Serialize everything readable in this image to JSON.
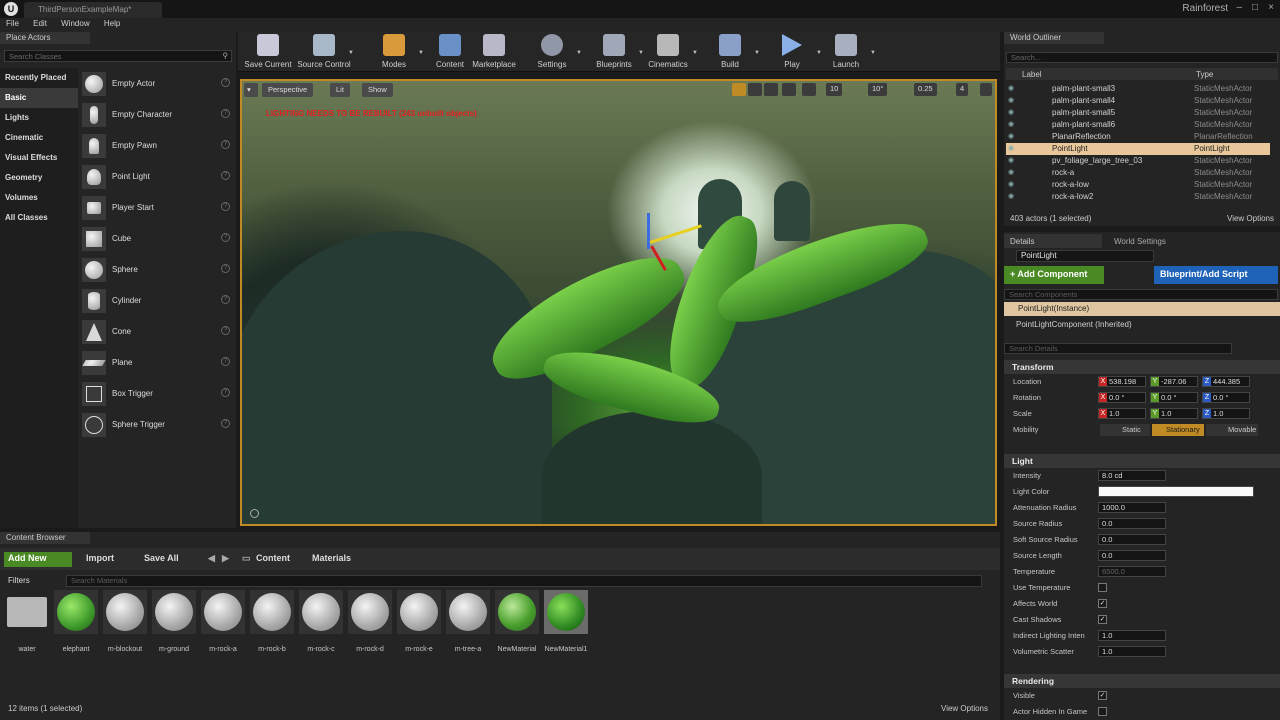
{
  "titlebar": {
    "tab": "ThirdPersonExampleMap*",
    "project": "Rainforest",
    "controls": [
      "–",
      "□",
      "×"
    ]
  },
  "menu": [
    "File",
    "Edit",
    "Window",
    "Help"
  ],
  "place_actors": {
    "tab": "Place Actors",
    "search_placeholder": "Search Classes",
    "categories": [
      "Recently Placed",
      "Basic",
      "Lights",
      "Cinematic",
      "Visual Effects",
      "Geometry",
      "Volumes",
      "All Classes"
    ],
    "active_category": "Basic",
    "items": [
      "Empty Actor",
      "Empty Character",
      "Empty Pawn",
      "Point Light",
      "Player Start",
      "Cube",
      "Sphere",
      "Cylinder",
      "Cone",
      "Plane",
      "Box Trigger",
      "Sphere Trigger"
    ]
  },
  "toolbar": [
    {
      "label": "Save Current",
      "color": "#d8d8e8"
    },
    {
      "label": "Source Control",
      "color": "#b8c8d8"
    },
    {
      "label": "Modes",
      "color": "#e0a040"
    },
    {
      "label": "Content",
      "color": "#7aa0d0"
    },
    {
      "label": "Marketplace",
      "color": "#c8c8d8"
    },
    {
      "label": "Settings",
      "color": "#a0a8b8"
    },
    {
      "label": "Blueprints",
      "color": "#b0b8c8"
    },
    {
      "label": "Cinematics",
      "color": "#c8c8c8"
    },
    {
      "label": "Build",
      "color": "#9ab0d8"
    },
    {
      "label": "Play",
      "color": "#8ab0e8"
    },
    {
      "label": "Launch",
      "color": "#b8c0d0"
    }
  ],
  "viewport": {
    "buttons": [
      "Perspective",
      "Lit",
      "Show"
    ],
    "warning": "LIGHTING NEEDS TO BE REBUILT (243 unbuilt objects)",
    "snap_values": [
      "10",
      "10°",
      "0.25",
      "4"
    ]
  },
  "outliner": {
    "tab": "World Outliner",
    "search_placeholder": "Search...",
    "col_label": "Label",
    "col_type": "Type",
    "rows": [
      {
        "name": "palm-plant-small3",
        "type": "StaticMeshActor"
      },
      {
        "name": "palm-plant-small4",
        "type": "StaticMeshActor"
      },
      {
        "name": "palm-plant-small5",
        "type": "StaticMeshActor"
      },
      {
        "name": "palm-plant-small6",
        "type": "StaticMeshActor"
      },
      {
        "name": "PlanarReflection",
        "type": "PlanarReflection"
      },
      {
        "name": "PointLight",
        "type": "PointLight"
      },
      {
        "name": "pv_foliage_large_tree_03",
        "type": "StaticMeshActor"
      },
      {
        "name": "rock-a",
        "type": "StaticMeshActor"
      },
      {
        "name": "rock-a-low",
        "type": "StaticMeshActor"
      },
      {
        "name": "rock-a-low2",
        "type": "StaticMeshActor"
      }
    ],
    "selected_row": "PointLight",
    "count": "403 actors (1 selected)",
    "view_options": "View Options"
  },
  "details": {
    "tab_details": "Details",
    "tab_world": "World Settings",
    "actor_name": "PointLight",
    "add_component": "+ Add Component",
    "blueprint_script": "Blueprint/Add Script",
    "search_components": "Search Components",
    "component_instance": "PointLight(Instance)",
    "component_light": "PointLightComponent (Inherited)",
    "search_details": "Search Details",
    "transform": {
      "title": "Transform",
      "location_label": "Location",
      "location": [
        "538.198",
        "-287.06",
        "444.385"
      ],
      "rotation_label": "Rotation",
      "rotation": [
        "0.0 °",
        "0.0 °",
        "0.0 °"
      ],
      "scale_label": "Scale",
      "scale": [
        "1.0",
        "1.0",
        "1.0"
      ],
      "mobility_label": "Mobility",
      "mobility": [
        "Static",
        "Stationary",
        "Movable"
      ]
    },
    "light": {
      "title": "Light",
      "props": [
        {
          "label": "Intensity",
          "value": "8.0 cd"
        },
        {
          "label": "Light Color",
          "value": ""
        },
        {
          "label": "Attenuation Radius",
          "value": "1000.0"
        },
        {
          "label": "Source Radius",
          "value": "0.0"
        },
        {
          "label": "Soft Source Radius",
          "value": "0.0"
        },
        {
          "label": "Source Length",
          "value": "0.0"
        },
        {
          "label": "Temperature",
          "value": "6500.0"
        }
      ],
      "checks": [
        {
          "label": "Use Temperature",
          "checked": false
        },
        {
          "label": "Affects World",
          "checked": true
        },
        {
          "label": "Cast Shadows",
          "checked": true
        }
      ],
      "indirect_label": "Indirect Lighting Inten",
      "indirect_value": "1.0",
      "volumetric_label": "Volumetric Scatter",
      "volumetric_value": "1.0"
    },
    "rendering": {
      "title": "Rendering",
      "visible": "Visible",
      "hidden_in_game": "Actor Hidden In Game"
    }
  },
  "content_browser": {
    "tab": "Content Browser",
    "add_new": "Add New",
    "import": "Import",
    "save_all": "Save All",
    "path": [
      "Content",
      "Materials"
    ],
    "filters": "Filters",
    "search_placeholder": "Search Materials",
    "assets": [
      {
        "name": "water",
        "kind": "folder"
      },
      {
        "name": "elephant",
        "kind": "green"
      },
      {
        "name": "m-blockout",
        "kind": "sphere"
      },
      {
        "name": "m-ground",
        "kind": "sphere"
      },
      {
        "name": "m-rock-a",
        "kind": "sphere"
      },
      {
        "name": "m-rock-b",
        "kind": "sphere"
      },
      {
        "name": "m-rock-c",
        "kind": "sphere"
      },
      {
        "name": "m-rock-d",
        "kind": "sphere"
      },
      {
        "name": "m-rock-e",
        "kind": "sphere"
      },
      {
        "name": "m-tree-a",
        "kind": "sphere"
      },
      {
        "name": "NewMaterial",
        "kind": "green"
      },
      {
        "name": "NewMaterial1",
        "kind": "green"
      }
    ],
    "selected_asset": "NewMaterial1",
    "count": "12 items (1 selected)",
    "view_options": "View Options"
  },
  "colors": {
    "accent_orange": "#c08a25",
    "green_button": "#4a8a24",
    "blue_button": "#1f63b8",
    "selection": "#e8c89a"
  }
}
